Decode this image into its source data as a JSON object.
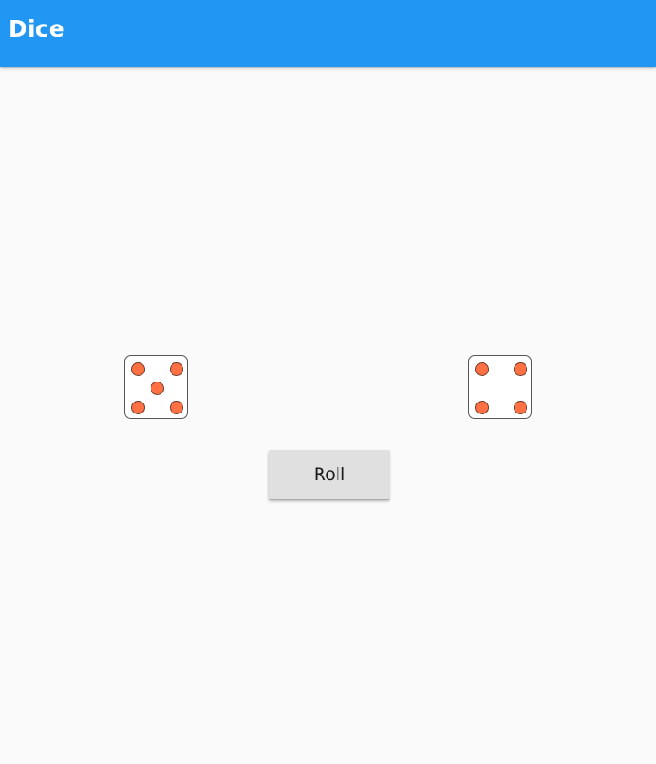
{
  "appbar": {
    "title": "Dice",
    "color": "#2196f3"
  },
  "dice": [
    {
      "name": "left-die",
      "value": 5
    },
    {
      "name": "right-die",
      "value": 4
    }
  ],
  "pip_color": "#ff7043",
  "roll_button": {
    "label": "Roll"
  }
}
